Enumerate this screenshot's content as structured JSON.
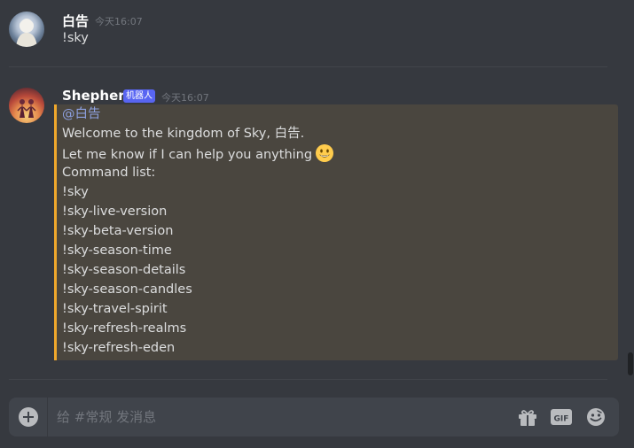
{
  "messages": [
    {
      "username": "白告",
      "timestamp": "今天16:07",
      "text": "!sky"
    },
    {
      "username": "Shepherd",
      "badge": "机器人",
      "timestamp": "今天16:07",
      "mention": "@白告",
      "lines": [
        "Welcome to the kingdom of Sky, 白告.",
        "Let me know if I can help you anything",
        "Command list:",
        "!sky",
        "!sky-live-version",
        "!sky-beta-version",
        "!sky-season-time",
        "!sky-season-details",
        "!sky-season-candles",
        "!sky-travel-spirit",
        "!sky-refresh-realms",
        "!sky-refresh-eden"
      ],
      "emoji": "smiley-emoji"
    }
  ],
  "composer": {
    "placeholder": "给 #常规 发消息"
  },
  "icons": {
    "add": "add-circle-icon",
    "gift": "gift-icon",
    "gif": "gif-icon",
    "emoji": "emoji-picker-icon"
  },
  "colors": {
    "background": "#36393f",
    "mention_highlight": "#4a463f",
    "mention_border": "#f0a82c",
    "mention_text": "#8ea1e1",
    "bot_badge": "#5865f2",
    "composer_bg": "#40444b"
  }
}
